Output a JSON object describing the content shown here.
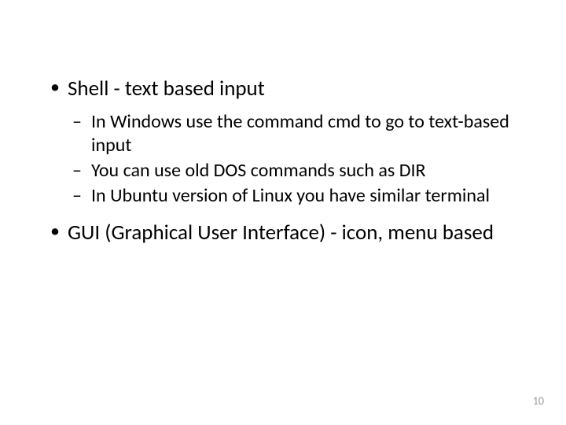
{
  "bullets": [
    {
      "text": "Shell - text based input",
      "sub": [
        "In  Windows use the command cmd to go to text-based input",
        "You can use old DOS commands such as DIR",
        "In Ubuntu version of Linux you have similar terminal"
      ]
    },
    {
      "text": "GUI (Graphical User Interface) - icon, menu based",
      "sub": []
    }
  ],
  "pageNumber": "10"
}
